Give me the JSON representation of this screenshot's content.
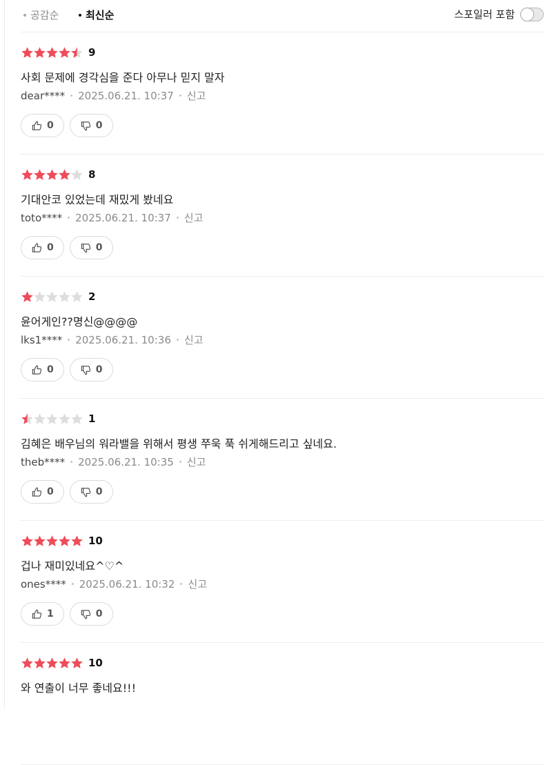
{
  "sort": {
    "popular_label": "공감순",
    "latest_label": "최신순"
  },
  "spoiler": {
    "label": "스포일러 포함",
    "enabled": false
  },
  "colors": {
    "star_filled": "#ee4c5a",
    "star_empty": "#dddddd"
  },
  "reviews": [
    {
      "stars": 4.5,
      "score": "9",
      "text": "사회 문제에 경각심을 준다 아무나 믿지 말자",
      "user": "dear****",
      "date": "2025.06.21. 10:37",
      "report": "신고",
      "likes": "0",
      "dislikes": "0"
    },
    {
      "stars": 4,
      "score": "8",
      "text": "기대안코 있었는데 재밌게 봤네요",
      "user": "toto****",
      "date": "2025.06.21. 10:37",
      "report": "신고",
      "likes": "0",
      "dislikes": "0"
    },
    {
      "stars": 1,
      "score": "2",
      "text": "윤어게인??명신@@@@",
      "user": "lks1****",
      "date": "2025.06.21. 10:36",
      "report": "신고",
      "likes": "0",
      "dislikes": "0"
    },
    {
      "stars": 0.5,
      "score": "1",
      "text": "김혜은 배우님의 워라밸을 위해서 평생 쭈욱 푹 쉬게해드리고 싶네요.",
      "user": "theb****",
      "date": "2025.06.21. 10:35",
      "report": "신고",
      "likes": "0",
      "dislikes": "0"
    },
    {
      "stars": 5,
      "score": "10",
      "text": "겁나 재미있네요^♡^",
      "user": "ones****",
      "date": "2025.06.21. 10:32",
      "report": "신고",
      "likes": "1",
      "dislikes": "0"
    },
    {
      "stars": 5,
      "score": "10",
      "text": "와 연출이 너무 좋네요!!!"
    }
  ]
}
